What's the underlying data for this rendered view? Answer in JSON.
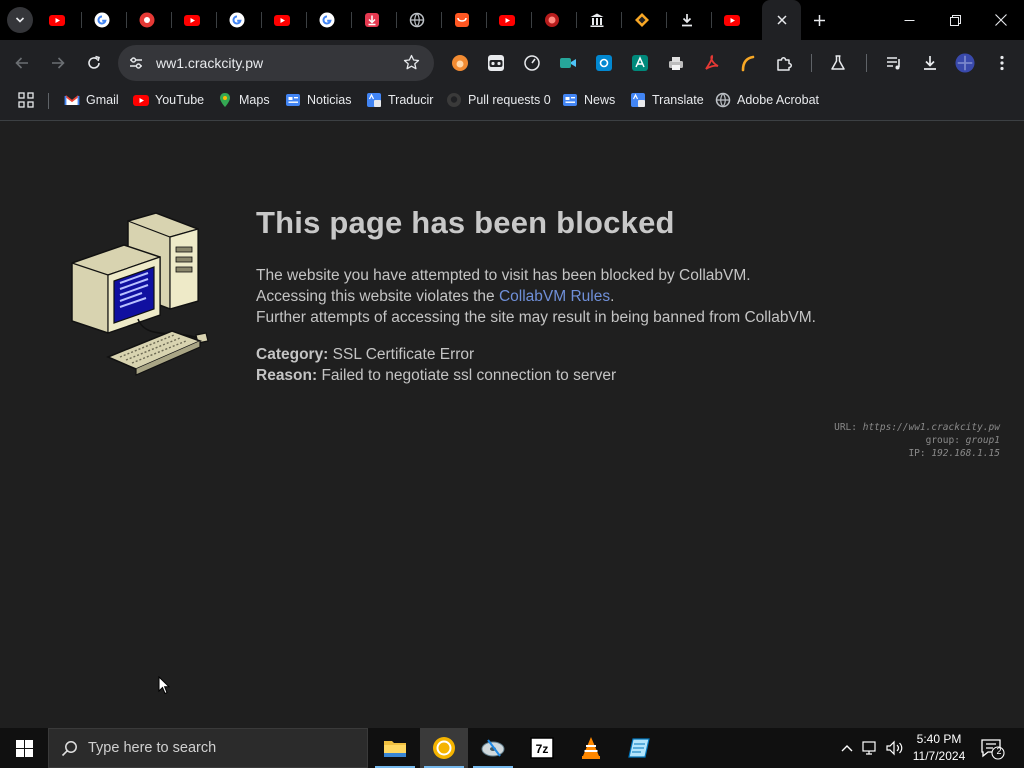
{
  "browser": {
    "tabs": [
      {
        "icon": "youtube-icon"
      },
      {
        "icon": "google-icon"
      },
      {
        "icon": "flower-icon"
      },
      {
        "icon": "youtube-icon"
      },
      {
        "icon": "google-icon"
      },
      {
        "icon": "youtube-icon"
      },
      {
        "icon": "google-icon"
      },
      {
        "icon": "download-red-icon"
      },
      {
        "icon": "globe-icon"
      },
      {
        "icon": "store-icon"
      },
      {
        "icon": "youtube-icon"
      },
      {
        "icon": "red-game-icon"
      },
      {
        "icon": "library-icon"
      },
      {
        "icon": "diamond-icon"
      },
      {
        "icon": "download-icon"
      },
      {
        "icon": "youtube-icon",
        "active": true
      }
    ],
    "address_url": "ww1.crackcity.pw",
    "bookmarks": [
      {
        "label": "Gmail",
        "icon": "gmail-icon"
      },
      {
        "label": "YouTube",
        "icon": "youtube-icon"
      },
      {
        "label": "Maps",
        "icon": "maps-icon"
      },
      {
        "label": "Noticias",
        "icon": "news-icon"
      },
      {
        "label": "Traducir",
        "icon": "translate-icon"
      },
      {
        "label": "Pull requests 0",
        "icon": "github-icon"
      },
      {
        "label": "News",
        "icon": "news-icon"
      },
      {
        "label": "Translate",
        "icon": "translate-icon"
      },
      {
        "label": "Adobe Acrobat",
        "icon": "globe-icon"
      }
    ]
  },
  "blocked_page": {
    "title": "This page has been blocked",
    "line1": "The website you have attempted to visit has been blocked by CollabVM.",
    "line2_pre": "Accessing this website violates the ",
    "line2_link": "CollabVM Rules",
    "line2_post": ".",
    "line3": "Further attempts of accessing the site may result in being banned from CollabVM.",
    "category_label": "Category:",
    "category_value": " SSL Certificate Error",
    "reason_label": "Reason:",
    "reason_value": " Failed to negotiate ssl connection to server",
    "meta_url_label": "URL:",
    "meta_url_value": "https://ww1.crackcity.pw",
    "meta_group_label": "group:",
    "meta_group_value": "group1",
    "meta_ip_label": "IP:",
    "meta_ip_value": "192.168.1.15"
  },
  "taskbar": {
    "search_placeholder": "Type here to search",
    "time": "5:40 PM",
    "date": "11/7/2024",
    "notification_count": "2"
  },
  "colors": {
    "link": "#6f8fd8",
    "accent": "#76b9ed"
  }
}
